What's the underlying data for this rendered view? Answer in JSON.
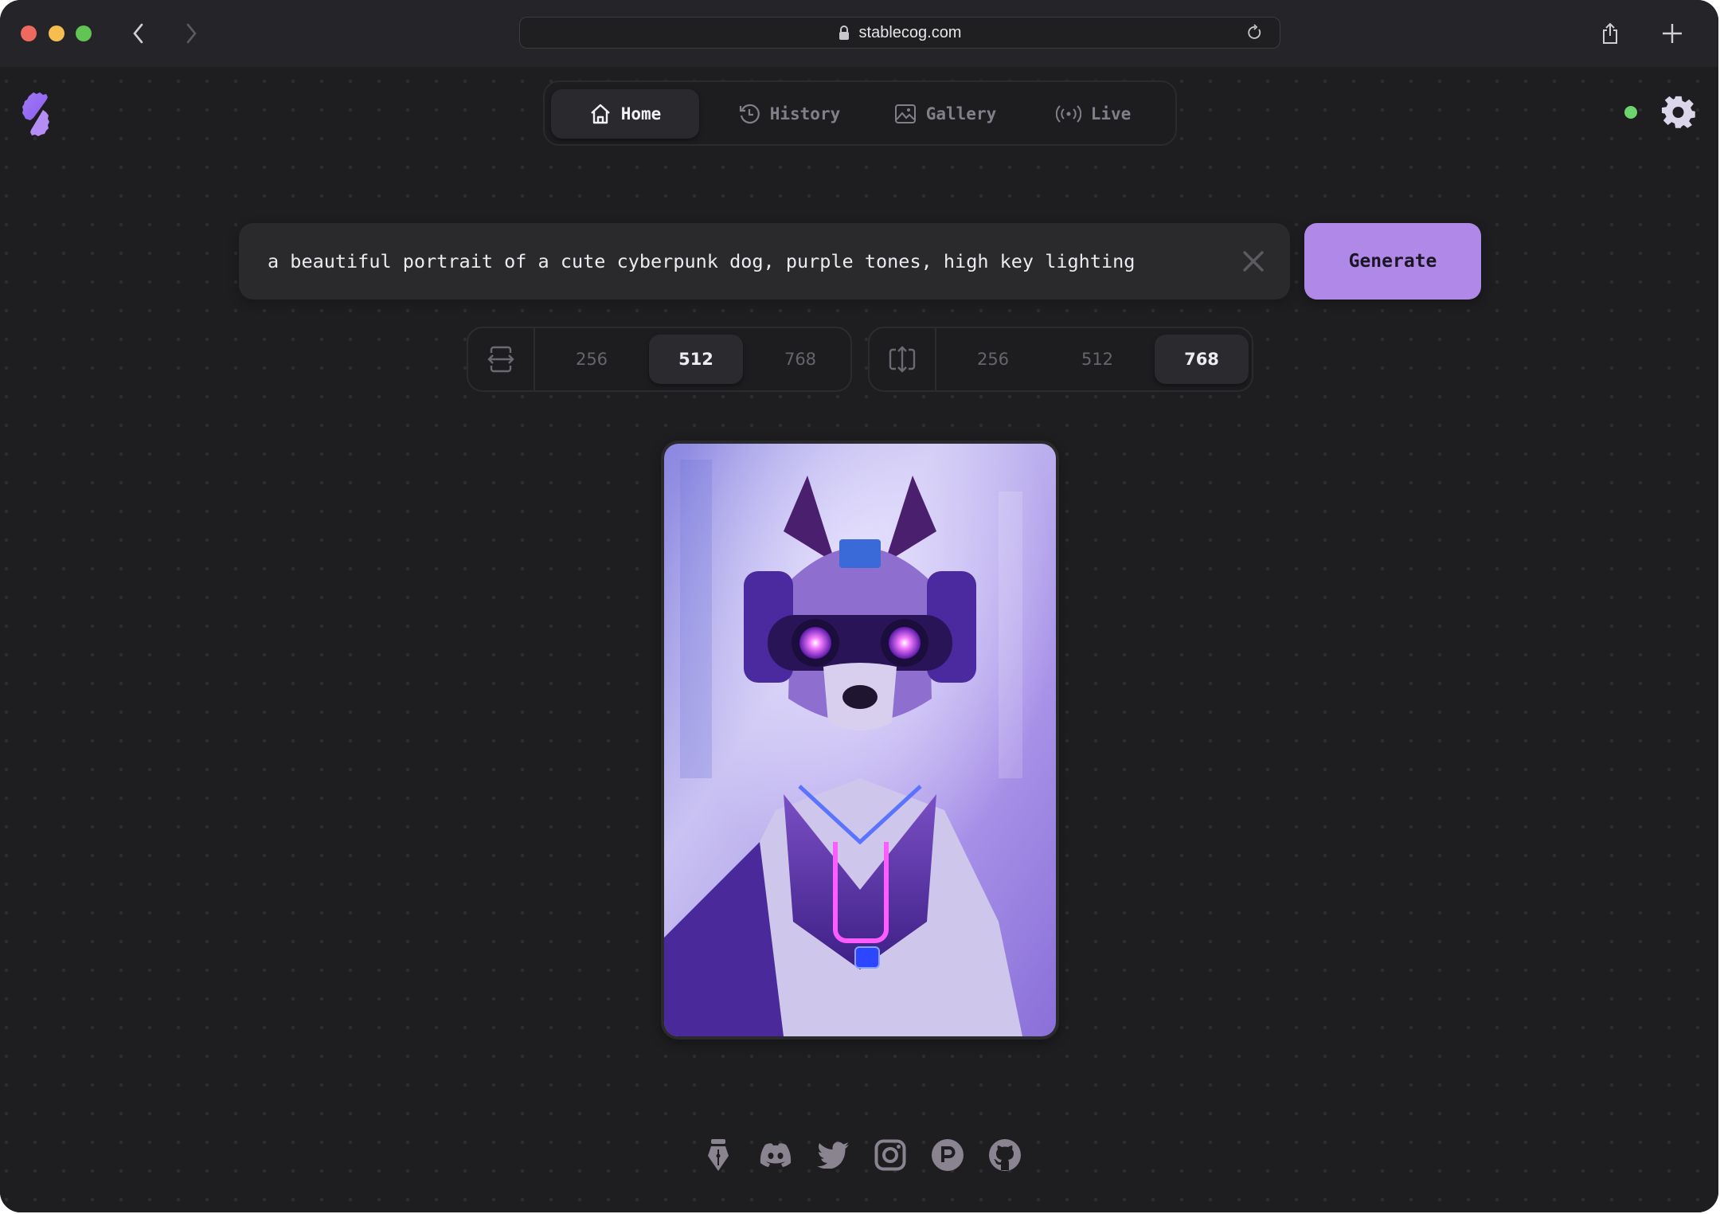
{
  "browser": {
    "url": "stablecog.com",
    "icons": [
      "back-icon",
      "forward-icon",
      "lock-icon",
      "reload-icon",
      "share-icon",
      "new-tab-icon"
    ]
  },
  "header": {
    "logo": "stablecog-logo",
    "tabs": [
      {
        "label": "Home",
        "icon": "home-icon",
        "active": true
      },
      {
        "label": "History",
        "icon": "history-icon",
        "active": false
      },
      {
        "label": "Gallery",
        "icon": "gallery-icon",
        "active": false
      },
      {
        "label": "Live",
        "icon": "live-icon",
        "active": false
      }
    ],
    "status_color": "#6cd46c",
    "settings_icon": "gear-icon"
  },
  "prompt": {
    "value": "a beautiful portrait of a cute cyberpunk dog, purple tones, high key lighting",
    "clear_icon": "close-icon",
    "generate_label": "Generate",
    "accent": "#b088e8"
  },
  "size": {
    "width": {
      "icon": "width-icon",
      "options": [
        "256",
        "512",
        "768"
      ],
      "selected": "512"
    },
    "height": {
      "icon": "height-icon",
      "options": [
        "256",
        "512",
        "768"
      ],
      "selected": "768"
    }
  },
  "image": {
    "alt": "a beautiful portrait of a cute cyberpunk dog, purple tones, high key lighting"
  },
  "footer": {
    "socials": [
      "blog-icon",
      "discord-icon",
      "twitter-icon",
      "instagram-icon",
      "producthunt-icon",
      "github-icon"
    ]
  }
}
